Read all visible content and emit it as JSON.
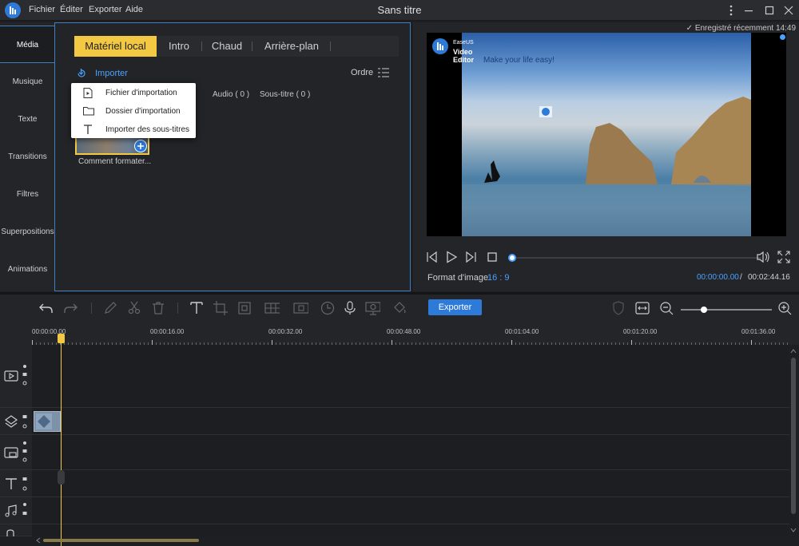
{
  "app": {
    "title": "Sans titre",
    "menu": [
      "Fichier",
      "Éditer",
      "Exporter",
      "Aide"
    ]
  },
  "sidebar": {
    "items": [
      "Média",
      "Musique",
      "Texte",
      "Transitions",
      "Filtres",
      "Superpositions",
      "Animations"
    ],
    "active": "Média"
  },
  "media": {
    "tabs": [
      "Matériel local",
      "Intro",
      "Chaud",
      "Arrière-plan"
    ],
    "active_tab": "Matériel local",
    "import_label": "Importer",
    "order_label": "Ordre",
    "filters": [
      "Audio ( 0 )",
      "Sous-titre ( 0 )"
    ],
    "thumbnail_caption": "Comment formater..."
  },
  "context_menu": {
    "items": [
      {
        "label": "Fichier d'importation",
        "icon": "file-play-icon"
      },
      {
        "label": "Dossier d'importation",
        "icon": "folder-icon"
      },
      {
        "label": "Importer des sous-titres",
        "icon": "text-t-icon"
      }
    ]
  },
  "preview": {
    "saved_label": "Enregistré récemment 14:49",
    "brand_small": "EaseUS",
    "brand_big": "Video Editor",
    "tagline": "Make your life easy!",
    "aspect_label": "Format d'image",
    "aspect_value": "16 : 9",
    "time_current": "00:00:00.00",
    "time_separator": "/",
    "time_total": "00:02:44.16",
    "progress": 0
  },
  "toolbar": {
    "export_label": "Exporter",
    "zoom_level": 0.25
  },
  "ruler": {
    "labels": [
      "00:00:00.00",
      "00:00:16.00",
      "00:00:32.00",
      "00:00:48.00",
      "00:01:04.00",
      "00:01:20.00",
      "00:01:36.00"
    ]
  },
  "colors": {
    "accent_blue": "#2e7ad8",
    "accent_yellow": "#f3c944",
    "background": "#1e1f22"
  }
}
